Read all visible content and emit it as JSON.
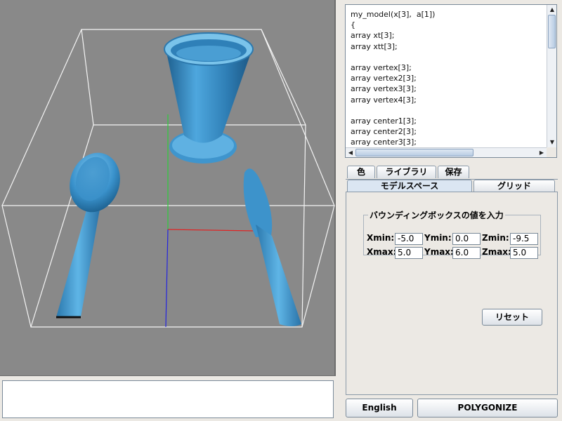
{
  "code_editor": {
    "lines": [
      "my_model(x[3],  a[1])",
      "{",
      "array xt[3];",
      "array xtt[3];",
      "",
      "array vertex[3];",
      "array vertex2[3];",
      "array vertex3[3];",
      "array vertex4[3];",
      "",
      "array center1[3];",
      "array center2[3];",
      "array center3[3];"
    ]
  },
  "tabs_row1": [
    "色",
    "ライブラリ",
    "保存"
  ],
  "tabs_row2": [
    "モデルスペース",
    "グリッド"
  ],
  "bounding_box": {
    "legend": "バウンディングボックスの値を入力",
    "xmin_label": "Xmin:",
    "xmin": "-5.0",
    "ymin_label": "Ymin:",
    "ymin": "0.0",
    "zmin_label": "Zmin:",
    "zmin": "-9.5",
    "xmax_label": "Xmax:",
    "xmax": "5.0",
    "ymax_label": "Ymax:",
    "ymax": "6.0",
    "zmax_label": "Zmax:",
    "zmax": "5.0"
  },
  "reset_label": "リセット",
  "english_label": "English",
  "polygonize_label": "POLYGONIZE",
  "colors": {
    "viewport_bg": "#898989",
    "model_blue": "#4aa3dc",
    "accent": "#dbe6f2"
  }
}
